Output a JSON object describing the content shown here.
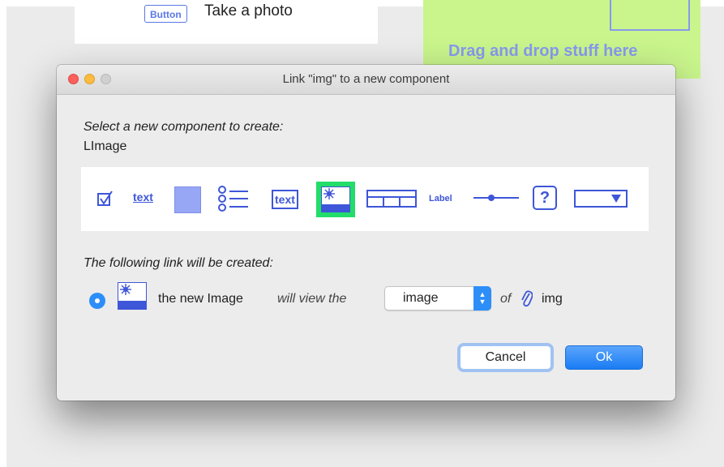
{
  "background": {
    "mini_button_label": "Button",
    "photo_label": "Take a photo",
    "drop_zone_text": "Drag and drop stuff here"
  },
  "dialog": {
    "title": "Link \"img\" to a new component",
    "select_prompt": "Select a new component to create:",
    "selected_component": "LImage",
    "palette": {
      "text_link_label": "text",
      "text_field_label": "text",
      "label_label": "Label",
      "help_glyph": "?",
      "selected_item": "image",
      "items": [
        "checkbox",
        "text-link",
        "panel",
        "list",
        "text-field",
        "image",
        "table",
        "label",
        "slider",
        "help",
        "dropdown"
      ]
    },
    "link_prompt": "The following link will be created:",
    "link": {
      "text_new": "the new Image",
      "text_view": "will view the",
      "property_value": "image",
      "text_of": "of",
      "target": "img"
    },
    "cancel_label": "Cancel",
    "ok_label": "Ok"
  },
  "colors": {
    "accent": "#2c8ef8",
    "component_blue": "#3e56d8",
    "selected_outline": "#22dd6a",
    "drop_zone": "#c9f58c"
  }
}
